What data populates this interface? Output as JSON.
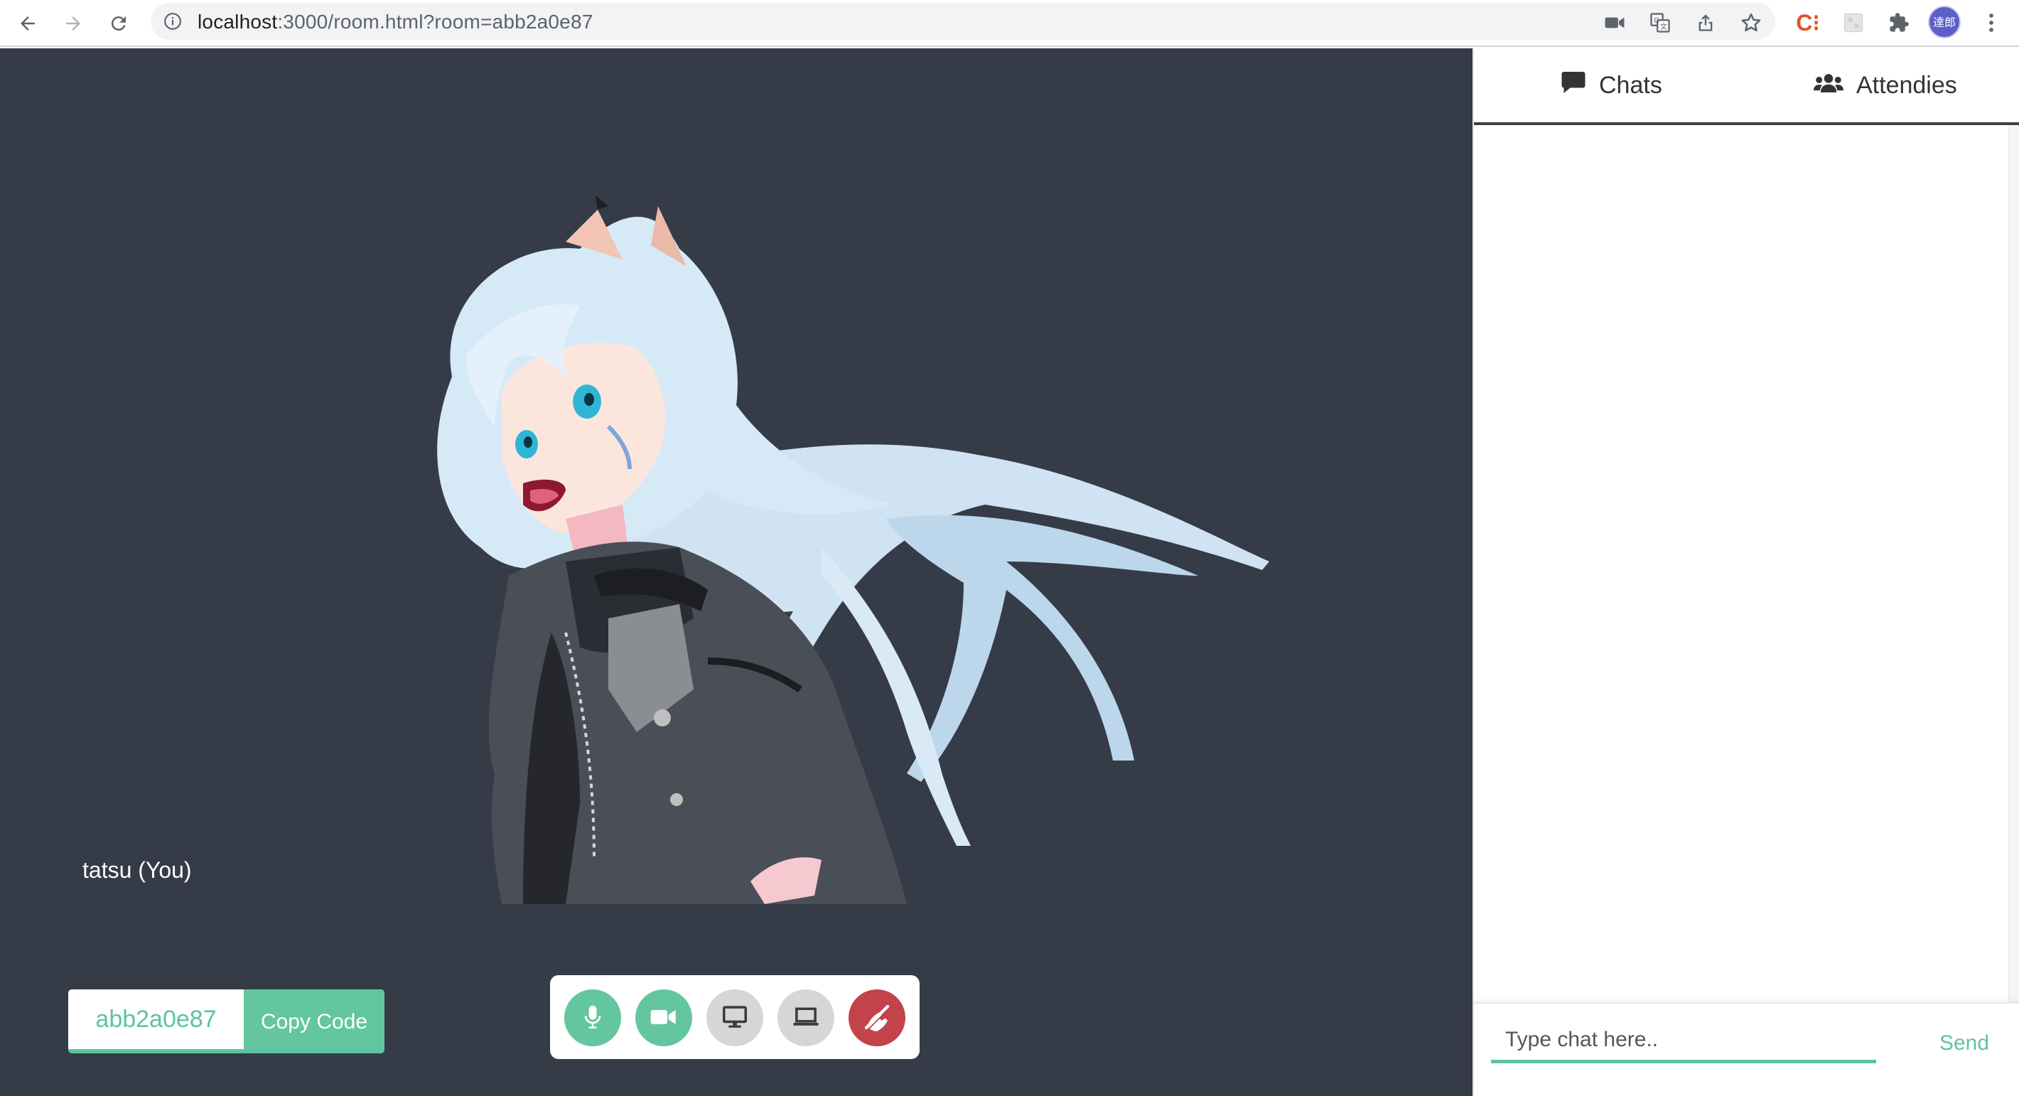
{
  "browser": {
    "url_host": "localhost",
    "url_rest": ":3000/room.html?room=abb2a0e87",
    "profile_initials": "達郎",
    "icons": [
      "back-icon",
      "forward-icon",
      "reload-icon",
      "info-icon",
      "camera-icon",
      "translate-icon",
      "share-icon",
      "star-icon",
      "extension-c-icon",
      "extension-blank-icon",
      "puzzle-icon",
      "menu-dots-icon"
    ],
    "extension_c_label": "C⁝"
  },
  "video": {
    "participant_label": "tatsu (You)"
  },
  "room": {
    "code": "abb2a0e87",
    "copy_label": "Copy Code"
  },
  "controls": [
    {
      "name": "mic",
      "icon": "microphone-icon",
      "state": "on",
      "color": "#63c69f"
    },
    {
      "name": "camera",
      "icon": "video-camera-icon",
      "state": "on",
      "color": "#63c69f"
    },
    {
      "name": "screen-share",
      "icon": "desktop-icon",
      "state": "off",
      "color": "#d6d6d6"
    },
    {
      "name": "whiteboard",
      "icon": "laptop-icon",
      "state": "off",
      "color": "#d6d6d6"
    },
    {
      "name": "leave-call",
      "icon": "hangup-icon",
      "state": "danger",
      "color": "#c2434a"
    }
  ],
  "panel": {
    "tabs": [
      {
        "label": "Chats",
        "icon": "chat-bubble-icon"
      },
      {
        "label": "Attendies",
        "icon": "users-icon"
      }
    ],
    "chat_placeholder": "Type chat here..",
    "send_label": "Send"
  },
  "colors": {
    "accent": "#5ec3a0",
    "stage_bg": "#363b48",
    "danger": "#c2434a"
  }
}
